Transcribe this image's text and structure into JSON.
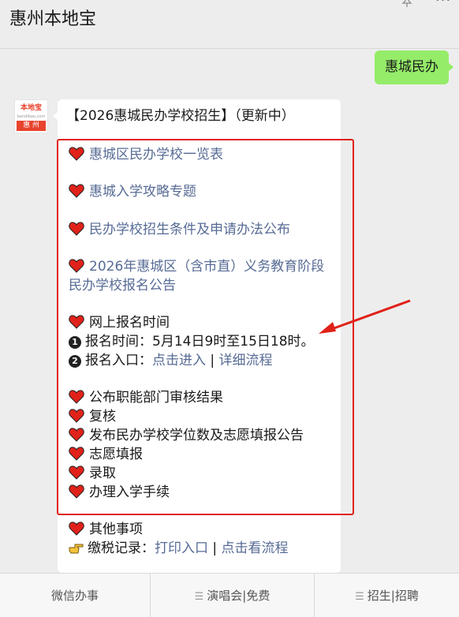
{
  "header": {
    "title": "惠州本地宝"
  },
  "outgoing_message": "惠城民办",
  "avatar": {
    "logo_top": "本地宝",
    "logo_mid": "bendibao.com",
    "logo_bottom": "惠 州"
  },
  "reply": {
    "heading": "【2026惠城民办学校招生】（更新中）",
    "links": [
      "惠城区民办学校一览表",
      "惠城入学攻略专题",
      "民办学校招生条件及申请办法公布",
      "2026年惠城区（含市直）义务教育阶段",
      "民办学校报名公告"
    ],
    "online": {
      "title": "网上报名时间",
      "num1": "1",
      "num2": "2",
      "time_line": "报名时间：5月14日9时至15日18时。",
      "entry_label": "报名入口：",
      "entry_link": "点击进入",
      "entry_sep": "|",
      "process_link": "详细流程"
    },
    "steps": [
      "公布职能部门审核结果",
      "复核",
      "发布民办学校学位数及志愿填报公告",
      "志愿填报",
      "录取",
      "办理入学手续"
    ],
    "other": "其他事项",
    "tax_label": "缴税记录：",
    "tax_link1": "打印入口",
    "tax_sep": "|",
    "tax_link2": "点击看流程"
  },
  "bottom_nav": [
    "微信办事",
    "演唱会|免费",
    "招生|招聘"
  ],
  "colors": {
    "link": "#576b95",
    "heart": "#e0221a",
    "outgoing_bubble": "#95ec69",
    "highlight_box": "#e0221a"
  }
}
